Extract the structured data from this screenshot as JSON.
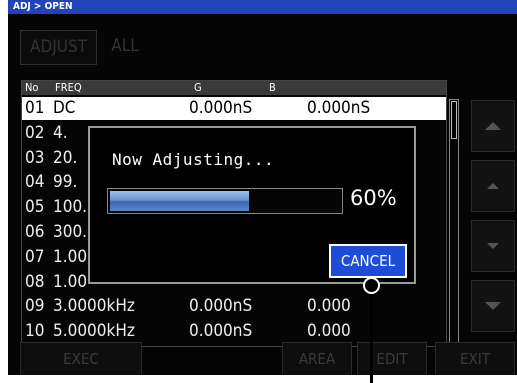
{
  "header": {
    "breadcrumb": "ADJ > OPEN"
  },
  "tabs": {
    "adjust": "ADJUST",
    "all": "ALL"
  },
  "table": {
    "columns": {
      "no": "No",
      "freq": "FREQ",
      "g": "G",
      "b": "B"
    },
    "rows": [
      {
        "no": "01",
        "freq": "DC",
        "g": "0.000nS",
        "b": "0.000nS"
      },
      {
        "no": "02",
        "freq": "4.",
        "g": "",
        "b": ""
      },
      {
        "no": "03",
        "freq": "20.",
        "g": "",
        "b": ""
      },
      {
        "no": "04",
        "freq": "99.",
        "g": "",
        "b": ""
      },
      {
        "no": "05",
        "freq": "100.",
        "g": "",
        "b": ""
      },
      {
        "no": "06",
        "freq": "300.",
        "g": "",
        "b": ""
      },
      {
        "no": "07",
        "freq": "1.00",
        "g": "",
        "b": ""
      },
      {
        "no": "08",
        "freq": "1.00",
        "g": "",
        "b": ""
      },
      {
        "no": "09",
        "freq": "3.0000kHz",
        "g": "0.000nS",
        "b": "0.000"
      },
      {
        "no": "10",
        "freq": "5.0000kHz",
        "g": "0.000nS",
        "b": "0.000"
      }
    ]
  },
  "bottom_buttons": {
    "exec": "EXEC",
    "area": "AREA",
    "edit": "EDIT",
    "exit": "EXIT"
  },
  "dialog": {
    "title": "Now Adjusting...",
    "progress_percent": 60,
    "progress_label": "60%",
    "cancel_label": "CANCEL"
  }
}
